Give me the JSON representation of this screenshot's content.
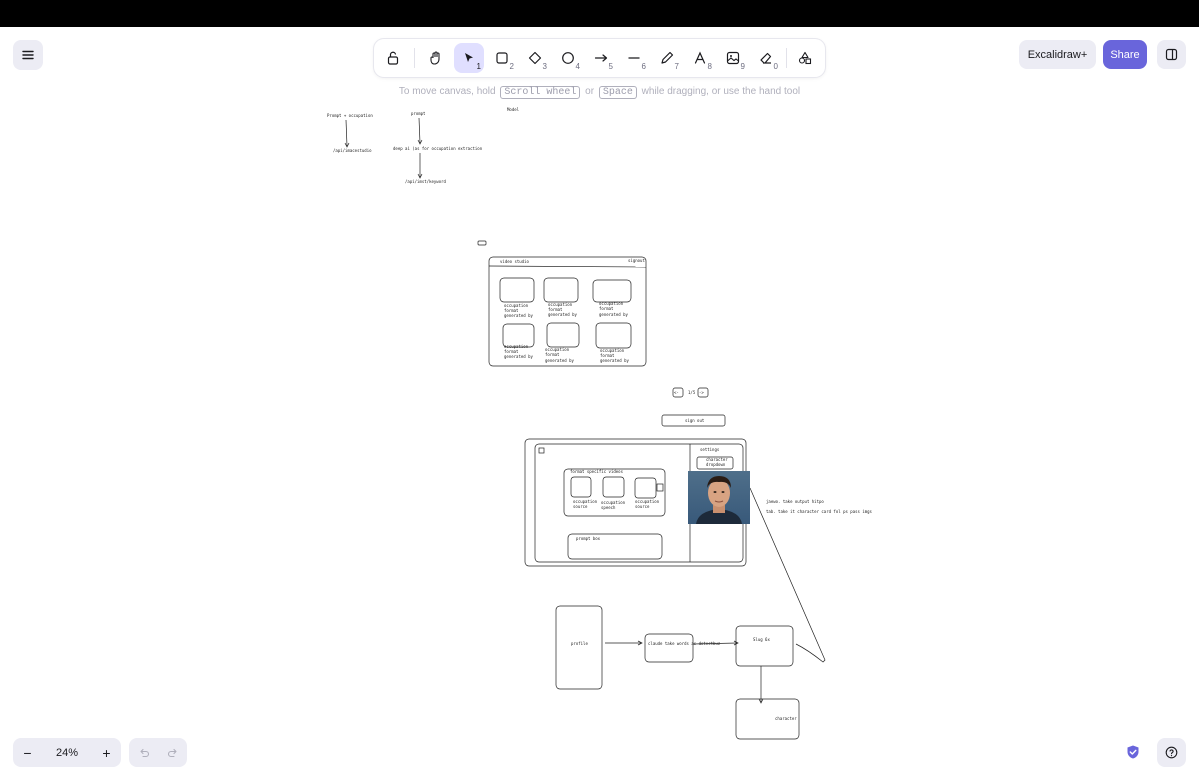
{
  "menu": {
    "icon": "hamburger-icon"
  },
  "toolbar": {
    "tools": [
      {
        "name": "lock",
        "icon": "lock-open-icon",
        "key": ""
      },
      {
        "name": "hand",
        "icon": "hand-icon",
        "key": ""
      },
      {
        "name": "selection",
        "icon": "cursor-arrow-icon",
        "key": "1"
      },
      {
        "name": "rectangle",
        "icon": "square-icon",
        "key": "2"
      },
      {
        "name": "diamond",
        "icon": "diamond-icon",
        "key": "3"
      },
      {
        "name": "ellipse",
        "icon": "circle-icon",
        "key": "4"
      },
      {
        "name": "arrow",
        "icon": "arrow-right-icon",
        "key": "5"
      },
      {
        "name": "line",
        "icon": "line-icon",
        "key": "6"
      },
      {
        "name": "draw",
        "icon": "pencil-icon",
        "key": "7"
      },
      {
        "name": "text",
        "icon": "text-icon",
        "key": "8"
      },
      {
        "name": "image",
        "icon": "image-icon",
        "key": "9"
      },
      {
        "name": "eraser",
        "icon": "eraser-icon",
        "key": "0"
      },
      {
        "name": "extra-tools",
        "icon": "shapes-icon",
        "key": ""
      }
    ],
    "active": "selection"
  },
  "header": {
    "excalidraw_plus_label": "Excalidraw+",
    "share_label": "Share",
    "library_icon": "library-sidebar-icon"
  },
  "hint": {
    "before": "To move canvas, hold",
    "key1": "Scroll wheel",
    "or": "or",
    "key2": "Space",
    "after": "while dragging, or use the hand tool"
  },
  "canvas": {
    "flow": {
      "prompt_occ": "Prompt + occupation",
      "prompt": "prompt",
      "model": "Model",
      "api_image": "/api/imacestudio",
      "deep_ai": "deep ai (as for occupation extraction",
      "api_keyword": "/api/imst/keyword"
    },
    "video_studio": {
      "title": "video studio",
      "signout": "signout",
      "card_text": [
        "occupation",
        "format",
        "generated by"
      ]
    },
    "pager": {
      "label": "1/5",
      "prev": "<-",
      "next": "->"
    },
    "signout_button": "sign out",
    "app": {
      "section_title": "format specific videos",
      "cards": [
        "occupation",
        "occupation",
        "occupation"
      ],
      "card_sub": [
        "source",
        "speech",
        "source"
      ],
      "prompt_box": "prompt box",
      "settings": "settings",
      "dropdown": [
        "character",
        "dropdown"
      ],
      "note1": "jaewo. take output hitpo",
      "note2": "tab. take it character card fol ps pass imgs"
    },
    "bottom_flow": {
      "profile": "profile",
      "claude": "claude take words as detectbuz",
      "slug": "Slug 6x",
      "character": "character"
    }
  },
  "footer": {
    "zoom": "24%",
    "zoom_out": "−",
    "zoom_in": "+",
    "undo_icon": "undo-icon",
    "redo_icon": "redo-icon",
    "help_icon": "help-icon",
    "check_icon": "shield-check-icon"
  }
}
